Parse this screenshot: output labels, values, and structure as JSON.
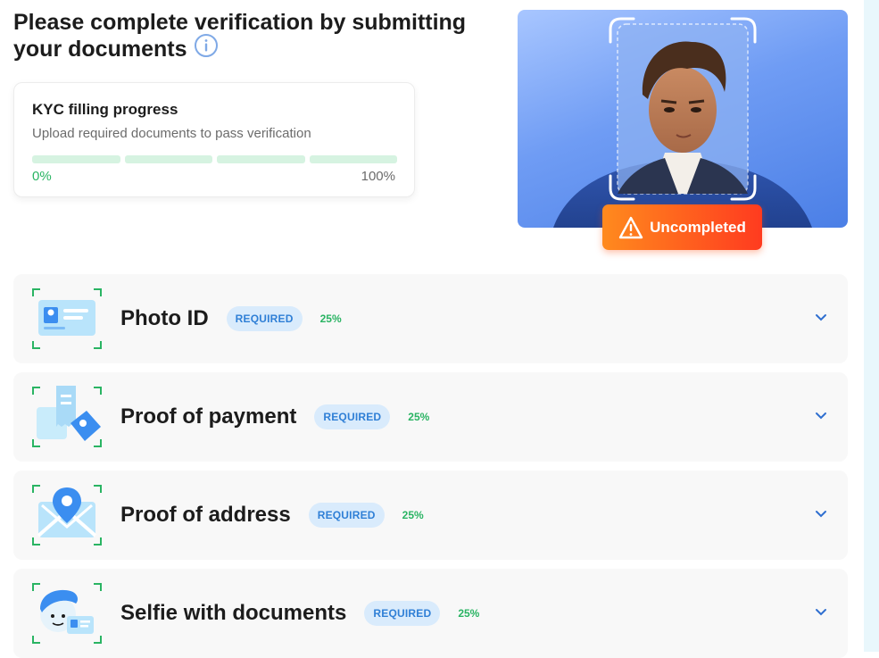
{
  "header": {
    "title": "Please complete verification by submitting your documents",
    "info_icon": "info-icon"
  },
  "progress": {
    "title": "KYC filling progress",
    "subtitle": "Upload required documents to pass verification",
    "segments": 4,
    "completed_segments": 0,
    "start_label": "0%",
    "end_label": "100%",
    "color": "#2ab463"
  },
  "status": {
    "label": "Uncompleted",
    "icon": "warning-icon"
  },
  "documents": [
    {
      "name": "Photo ID",
      "badge": "REQUIRED",
      "percent": "25%",
      "icon": "id-card-icon"
    },
    {
      "name": "Proof of payment",
      "badge": "REQUIRED",
      "percent": "25%",
      "icon": "payment-receipt-icon"
    },
    {
      "name": "Proof of address",
      "badge": "REQUIRED",
      "percent": "25%",
      "icon": "map-pin-icon"
    },
    {
      "name": "Selfie with documents",
      "badge": "REQUIRED",
      "percent": "25%",
      "icon": "selfie-icon"
    }
  ],
  "colors": {
    "accent_green": "#2ab463",
    "badge_blue": "#2f7fd6",
    "status_orange": "#ff6a1e"
  }
}
